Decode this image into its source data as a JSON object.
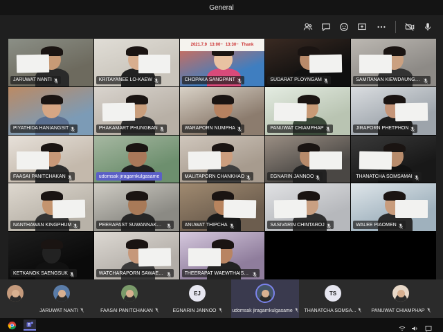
{
  "window": {
    "title": "General"
  },
  "toolbar": {
    "icons": [
      "people-icon",
      "chat-icon",
      "reactions-icon",
      "share-screen-icon",
      "more-icon",
      "camera-off-icon",
      "mic-icon"
    ]
  },
  "overlay_text": {
    "date": "2021.7.9",
    "time": "13:00~",
    "time2": "13:30~",
    "poster": "Thank"
  },
  "grid": {
    "tiles": [
      {
        "name": "JARUWAT NANTI",
        "bg": "#6d6a5e",
        "c1": "#8b8f86",
        "paper": true,
        "skin": "#c79a76",
        "shirt": "#2a2a2a"
      },
      {
        "name": "KRITAYANEE LO-KAEW",
        "bg": "#c9c4bb",
        "c1": "#e0ddd6",
        "paper": true,
        "skin": "#d8ae8e",
        "shirt": "#222"
      },
      {
        "name": "CHOPAKA SANGPANT",
        "bg": "#3f7ec0",
        "c1": "#e86a4a",
        "paper": false,
        "skin": "#e8c2a2",
        "shirt": "#d94a7a"
      },
      {
        "name": "SUDARAT PLOYNGAM",
        "bg": "#0f0f0f",
        "c1": "#3a2a22",
        "paper": true,
        "skin": "#b98a6a",
        "shirt": "#111"
      },
      {
        "name": "SAMITANAN KIEWDAUNGDEE",
        "bg": "#8d8a86",
        "c1": "#bcb8b2",
        "paper": true,
        "skin": "#caa080",
        "shirt": "#333"
      },
      {
        "name": "PIYATHIDA HANIANGSIT",
        "bg": "#7c9bb6",
        "c1": "#bb8a64",
        "paper": false,
        "skin": "#d6a684",
        "shirt": "#5a6f90"
      },
      {
        "name": "PHAKAMART PHUNGBAN",
        "bg": "#b8b0a6",
        "c1": "#d9d4ce",
        "paper": true,
        "skin": "#c99e7c",
        "shirt": "#2e2e2e"
      },
      {
        "name": "WARAPORN NUMPHA",
        "bg": "#8c7c6e",
        "c1": "#d8d1c6",
        "paper": false,
        "skin": "#b78260",
        "shirt": "#1e1e1e"
      },
      {
        "name": "PANUWAT CHIAMPHAP",
        "bg": "#b9c4b2",
        "c1": "#e4ece2",
        "paper": true,
        "skin": "#c89a76",
        "shirt": "#3b4a3a"
      },
      {
        "name": "JIRAPORN PHETPHON",
        "bg": "#9da4ab",
        "c1": "#dadde0",
        "paper": true,
        "skin": "#c59578",
        "shirt": "#1c1c1c"
      },
      {
        "name": "FAASAI PANITCHAKAN",
        "bg": "#c4b9ac",
        "c1": "#e7e1da",
        "paper": true,
        "skin": "#c89878",
        "shirt": "#2b2b2b"
      },
      {
        "name": "udomsak jiragarnkulgasame",
        "bg": "#6d8f6e",
        "c1": "#a7b8a2",
        "paper": false,
        "skin": "#a9785a",
        "shirt": "#202020",
        "active": true
      },
      {
        "name": "MALITAPORN CHANKHAO",
        "bg": "#a79b8e",
        "c1": "#d0c7bd",
        "paper": true,
        "skin": "#cc9e7e",
        "shirt": "#3e3e3e"
      },
      {
        "name": "EGNARIN JANNOO",
        "bg": "#4a4744",
        "c1": "#9b8f84",
        "paper": true,
        "skin": "#b78a6a",
        "shirt": "#222"
      },
      {
        "name": "THANATCHA SOMSAMAI",
        "bg": "#181818",
        "c1": "#3a3a3a",
        "paper": true,
        "skin": "#b88c6c",
        "shirt": "#111"
      },
      {
        "name": "NANTHAWAN KINGPHUM",
        "bg": "#b8b2a8",
        "c1": "#ded8cf",
        "paper": true,
        "skin": "#c4946e",
        "shirt": "#333"
      },
      {
        "name": "PEERAPAST SUWANNAKORN",
        "bg": "#8b8a84",
        "c1": "#cfccc4",
        "paper": false,
        "skin": "#a87a58",
        "shirt": "#262626"
      },
      {
        "name": "ANUWAT THIPCHA",
        "bg": "#6c5d4e",
        "c1": "#a08a70",
        "paper": true,
        "skin": "#b8845e",
        "shirt": "#1a1a1a"
      },
      {
        "name": "SASIVARIN CHINTAROJ",
        "bg": "#b6b8bc",
        "c1": "#e1e2e4",
        "paper": true,
        "skin": "#c9a082",
        "shirt": "#303030"
      },
      {
        "name": "WALEE PIAOMEN",
        "bg": "#9fb1bd",
        "c1": "#dfe6ea",
        "paper": true,
        "skin": "#c89c7c",
        "shirt": "#2a2a2a"
      },
      {
        "name": "KETKANOK SAENGSUK",
        "bg": "#0a0a0a",
        "c1": "#1e1e1e",
        "paper": false,
        "skin": "#222",
        "shirt": "#111"
      },
      {
        "name": "WATCHARAPORN SAWAENG...",
        "bg": "#b3aea8",
        "c1": "#ddd9d3",
        "paper": true,
        "skin": "#c6987a",
        "shirt": "#3a3a3a"
      },
      {
        "name": "THEERAPAT WAEWTHAISONG",
        "bg": "#8f7d9c",
        "c1": "#d6c9de",
        "paper": true,
        "skin": "#b88462",
        "shirt": "#222"
      }
    ]
  },
  "strip": {
    "participants": [
      {
        "name": "",
        "initials": "",
        "color": "#c49a7c",
        "photo": true
      },
      {
        "name": "JARUWAT NANTI",
        "initials": "",
        "color": "#5a7ca8",
        "photo": true
      },
      {
        "name": "FAASAI PANITCHAKAN",
        "initials": "",
        "color": "#7a9a6a",
        "photo": true
      },
      {
        "name": "EGNARIN JANNOO",
        "initials": "EJ",
        "color": "#e6e6f0",
        "photo": false
      },
      {
        "name": "udomsak jiragarnkulgasame",
        "initials": "",
        "color": "#445566",
        "photo": true,
        "active": true
      },
      {
        "name": "THANATCHA SOMSA...",
        "initials": "TS",
        "color": "#e6e6f0",
        "photo": false
      },
      {
        "name": "PANUWAT CHIAMPHAP",
        "initials": "",
        "color": "#e8d8c8",
        "photo": true
      }
    ]
  },
  "taskbar": {
    "apps": [
      "chrome-icon",
      "teams-icon"
    ]
  },
  "colors": {
    "accent": "#5b5fc7",
    "titlebar": "#141414",
    "stage": "#1f1f1f"
  }
}
